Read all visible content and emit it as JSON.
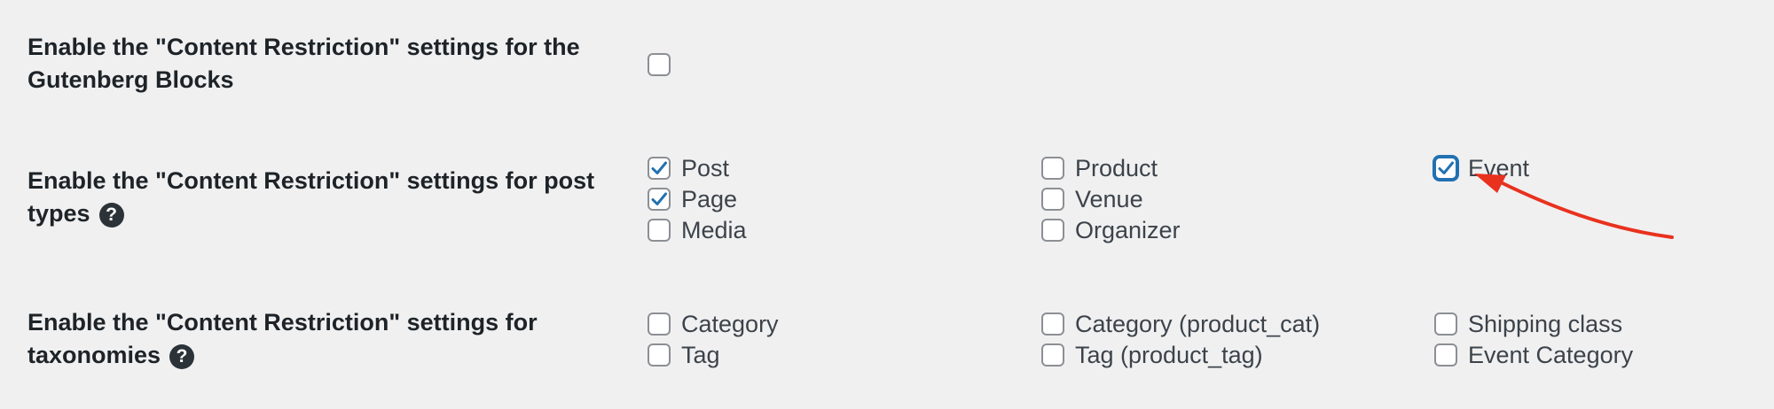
{
  "rows": [
    {
      "label": "Enable the \"Content Restriction\" settings for the Gutenberg Blocks",
      "has_help": false,
      "options": [
        {
          "label": "",
          "checked": false
        }
      ]
    },
    {
      "label": "Enable the \"Content Restriction\" settings for post types",
      "has_help": true,
      "help_glyph": "?",
      "options": [
        {
          "label": "Post",
          "checked": true
        },
        {
          "label": "Page",
          "checked": true
        },
        {
          "label": "Media",
          "checked": false
        },
        {
          "label": "Product",
          "checked": false
        },
        {
          "label": "Venue",
          "checked": false
        },
        {
          "label": "Organizer",
          "checked": false
        },
        {
          "label": "Event",
          "checked": true,
          "focused": true
        }
      ]
    },
    {
      "label": "Enable the \"Content Restriction\" settings for taxonomies",
      "has_help": true,
      "help_glyph": "?",
      "options": [
        {
          "label": "Category",
          "checked": false
        },
        {
          "label": "Tag",
          "checked": false
        },
        {
          "label": "Category (product_cat)",
          "checked": false
        },
        {
          "label": "Tag (product_tag)",
          "checked": false
        },
        {
          "label": "Shipping class",
          "checked": false
        },
        {
          "label": "Event Category",
          "checked": false
        }
      ]
    }
  ],
  "colors": {
    "background": "#f0f0f1",
    "checkmark": "#2271b1",
    "focus_border": "#2271b1",
    "annotation_arrow": "#e8321e"
  },
  "icons": {
    "help": "question-circle-icon",
    "check": "checkmark-icon",
    "annotation": "red-arrow-annotation"
  }
}
